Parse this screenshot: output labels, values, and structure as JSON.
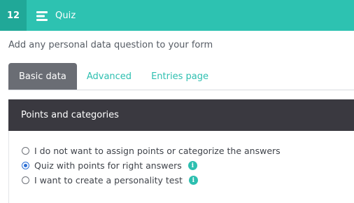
{
  "header": {
    "step_number": "12",
    "title": "Quiz",
    "menu_icon": "menu-icon"
  },
  "subtitle": "Add any personal data question to your form",
  "tabs": [
    {
      "label": "Basic data",
      "active": true
    },
    {
      "label": "Advanced",
      "active": false
    },
    {
      "label": "Entries page",
      "active": false
    }
  ],
  "section": {
    "title": "Points and categories",
    "options": [
      {
        "label": "I do not want to assign points or categorize the answers",
        "selected": false,
        "has_info": false
      },
      {
        "label": "Quiz with points for right answers",
        "selected": true,
        "has_info": true
      },
      {
        "label": "I want to create a personality test",
        "selected": false,
        "has_info": true
      }
    ],
    "info_glyph": "i"
  },
  "colors": {
    "accent": "#2dc2b1",
    "accent_dark": "#20a898",
    "active_tab": "#6a6d74",
    "section_bar": "#3a3940",
    "radio_selected": "#2b6fd6"
  }
}
